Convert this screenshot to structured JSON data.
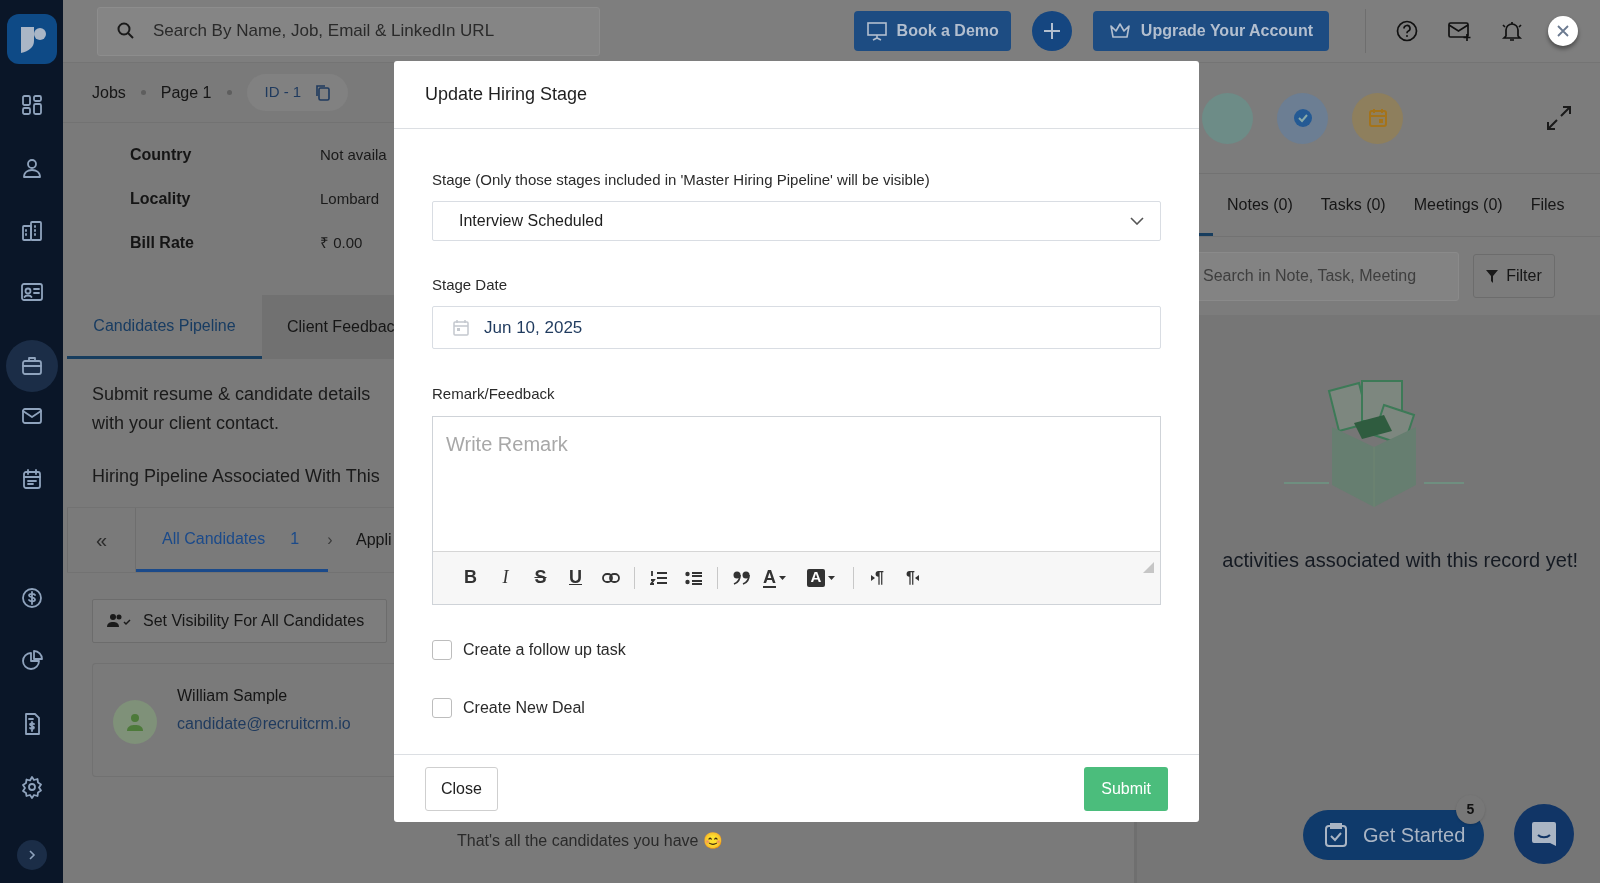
{
  "header": {
    "search_placeholder": "Search By Name, Job, Email & LinkedIn URL",
    "book_demo": "Book a Demo",
    "upgrade": "Upgrade Your Account"
  },
  "sidebar": {
    "items": [
      {
        "selected": false
      },
      {
        "selected": false
      },
      {
        "selected": false
      },
      {
        "selected": false
      },
      {
        "selected": true
      },
      {
        "selected": false
      },
      {
        "selected": false
      },
      {
        "selected": false
      },
      {
        "selected": false
      },
      {
        "selected": false
      },
      {
        "selected": false
      }
    ]
  },
  "breadcrumb": [
    "Jobs",
    "Page 1"
  ],
  "record_id": "ID - 1",
  "details": [
    {
      "label": "Country",
      "value": "Not availa"
    },
    {
      "label": "Locality",
      "value": "Lombard"
    },
    {
      "label": "Bill Rate",
      "value": "₹ 0.00"
    }
  ],
  "tabs": [
    {
      "label": "Candidates Pipeline",
      "selected": true
    },
    {
      "label": "Client Feedbac",
      "selected": false
    }
  ],
  "intro_lines": [
    "Submit resume & candidate details",
    "with your client contact."
  ],
  "pipeline_heading": "Hiring Pipeline Associated With This",
  "stages": {
    "prev": "«",
    "next": "›",
    "items": [
      {
        "label": "All Candidates",
        "count": "1",
        "selected": true
      },
      {
        "label": "Appli",
        "selected": false
      }
    ]
  },
  "visibility_button": "Set Visibility For All Candidates",
  "candidate": {
    "name": "William Sample",
    "email": "candidate@recruitcrm.io"
  },
  "end_note": "That's all the candidates you have 😊",
  "activity": {
    "tabs": [
      {
        "selected": true
      },
      {
        "label": "Notes (0)",
        "selected": false
      },
      {
        "label": "Tasks (0)",
        "selected": false
      },
      {
        "label": "Meetings (0)",
        "selected": false
      },
      {
        "label": "Files",
        "selected": false
      }
    ],
    "search_placeholder": "Search in Note, Task, Meeting",
    "filter": "Filter",
    "empty_text": "activities associated with this record yet!"
  },
  "get_started": {
    "label": "Get Started",
    "badge": "5"
  },
  "modal": {
    "title": "Update Hiring Stage",
    "stage_label": "Stage (Only those stages included in 'Master Hiring Pipeline' will be visible)",
    "stage_value": "Interview Scheduled",
    "date_label": "Stage Date",
    "date_value": "Jun 10, 2025",
    "remark_label": "Remark/Feedback",
    "remark_placeholder": "Write Remark",
    "toolbar": [
      {
        "kind": "bold",
        "glyph": "B"
      },
      {
        "kind": "italic",
        "glyph": "I"
      },
      {
        "kind": "strike",
        "glyph": "S"
      },
      {
        "kind": "underline",
        "glyph": "U"
      },
      {
        "kind": "link"
      },
      {
        "kind": "divider"
      },
      {
        "kind": "ordered-list"
      },
      {
        "kind": "bullet-list"
      },
      {
        "kind": "divider"
      },
      {
        "kind": "quote"
      },
      {
        "kind": "text-color",
        "glyph": "A"
      },
      {
        "kind": "background-color",
        "glyph": "A"
      },
      {
        "kind": "divider"
      },
      {
        "kind": "ltr",
        "glyph": "¶"
      },
      {
        "kind": "rtl",
        "glyph": "¶"
      }
    ],
    "options": [
      {
        "label": "Create a follow up task",
        "checked": false
      },
      {
        "label": "Create New Deal",
        "checked": false
      }
    ],
    "buttons": [
      {
        "kind": "secondary",
        "label": "Close"
      },
      {
        "kind": "primary",
        "label": "Submit"
      }
    ]
  }
}
